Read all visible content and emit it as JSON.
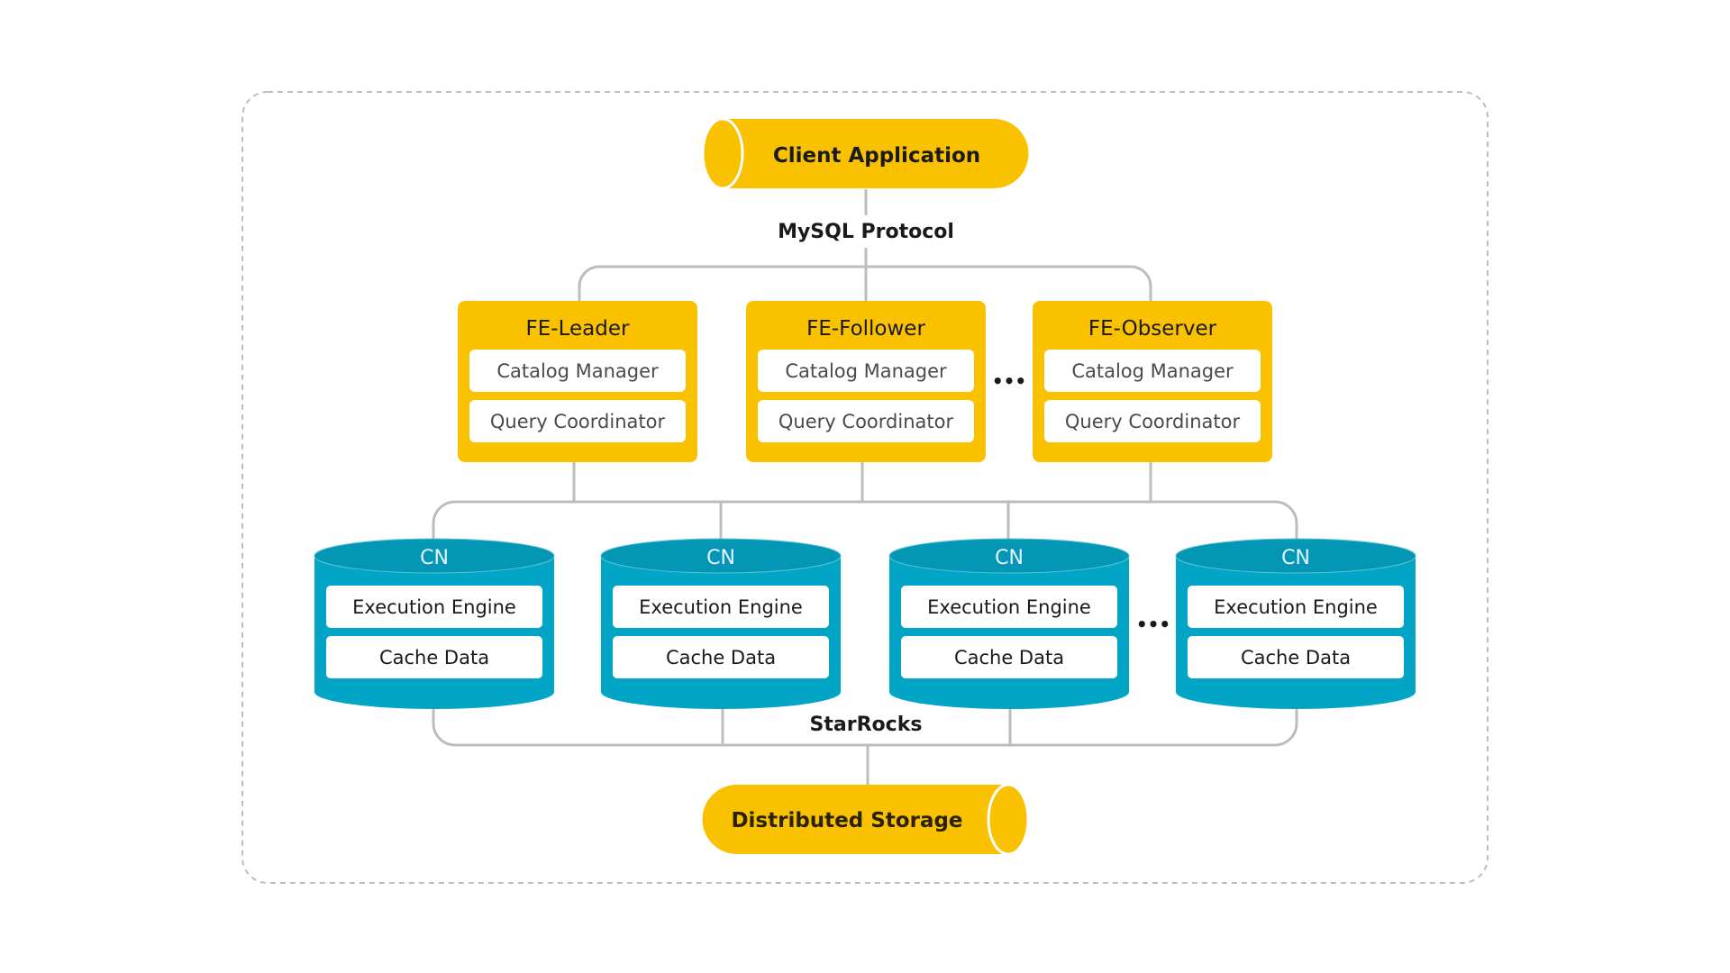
{
  "diagram": {
    "title": "StarRocks",
    "colors": {
      "frontend": "#F9C100",
      "compute": "#02A5C5",
      "compute_top": "#0497B5",
      "connector": "#BDBDBD",
      "border": "#BDBDBD",
      "inner_box": "#FFFFFF",
      "text_dark": "#1A1A1A",
      "text_gray": "#4A4A4A"
    },
    "client": {
      "label": "Client Application"
    },
    "protocol_label": "MySQL Protocol",
    "frontends": [
      {
        "title": "FE-Leader",
        "components": [
          "Catalog Manager",
          "Query Coordinator"
        ]
      },
      {
        "title": "FE-Follower",
        "components": [
          "Catalog Manager",
          "Query Coordinator"
        ]
      },
      {
        "title": "FE-Observer",
        "components": [
          "Catalog Manager",
          "Query Coordinator"
        ]
      }
    ],
    "fe_ellipsis": "•••",
    "compute_nodes": [
      {
        "title": "CN",
        "components": [
          "Execution Engine",
          "Cache Data"
        ]
      },
      {
        "title": "CN",
        "components": [
          "Execution Engine",
          "Cache Data"
        ]
      },
      {
        "title": "CN",
        "components": [
          "Execution Engine",
          "Cache  Data"
        ]
      },
      {
        "title": "CN",
        "components": [
          "Execution Engine",
          "Cache  Data"
        ]
      }
    ],
    "cn_ellipsis": "•••",
    "cluster_label": "StarRocks",
    "storage": {
      "label": "Distributed Storage"
    }
  }
}
